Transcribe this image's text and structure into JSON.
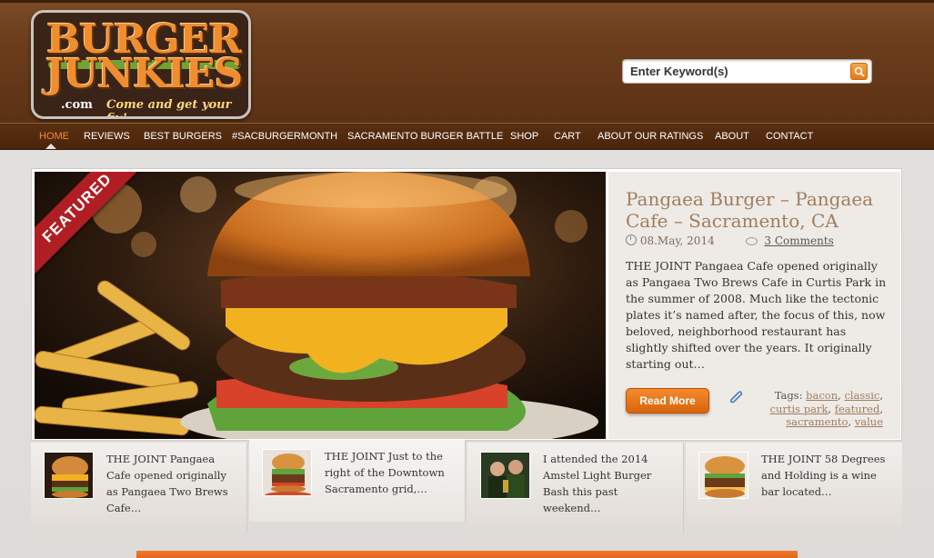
{
  "logo": {
    "line1": "BURGER",
    "line2": "JUNKIES",
    "com": ".com",
    "tagline": "Come and get your fix!"
  },
  "search": {
    "placeholder": "Enter Keyword(s)"
  },
  "nav": {
    "items": [
      "HOME",
      "REVIEWS",
      "BEST BURGERS",
      "#SACBURGERMONTH",
      "SACRAMENTO BURGER BATTLE",
      "SHOP",
      "CART",
      "ABOUT OUR RATINGS",
      "ABOUT",
      "CONTACT"
    ],
    "active": "HOME"
  },
  "featured": {
    "ribbon": "FEATURED",
    "title": "Pangaea Burger – Pangaea Cafe – Sacramento, CA",
    "date": "08.May, 2014",
    "comments": "3 Comments",
    "excerpt": "THE JOINT Pangaea Cafe opened originally as Pangaea Two Brews Cafe in Curtis Park in the summer of 2008. Much like the tectonic plates it’s named after, the focus of this, now beloved, neighborhood restaurant has slightly shifted over the years. It originally starting out…",
    "read_more": "Read More",
    "tags_label": "Tags:",
    "tags": [
      "bacon",
      "classic",
      "curtis park",
      "featured",
      "sacramento",
      "value"
    ]
  },
  "thumbs": [
    {
      "text": "THE JOINT Pangaea Cafe opened originally as Pangaea Two Brews Cafe…"
    },
    {
      "text": "THE JOINT Just to the right of the Downtown Sacramento grid,…"
    },
    {
      "text": "I attended the 2014 Amstel Light Burger Bash this past weekend…"
    },
    {
      "text": "THE JOINT 58 Degrees and Holding is a wine bar located…"
    }
  ],
  "colors": {
    "accent": "#f58a2e",
    "header_brown": "#6b3d1c",
    "ribbon_red": "#b01e23"
  }
}
